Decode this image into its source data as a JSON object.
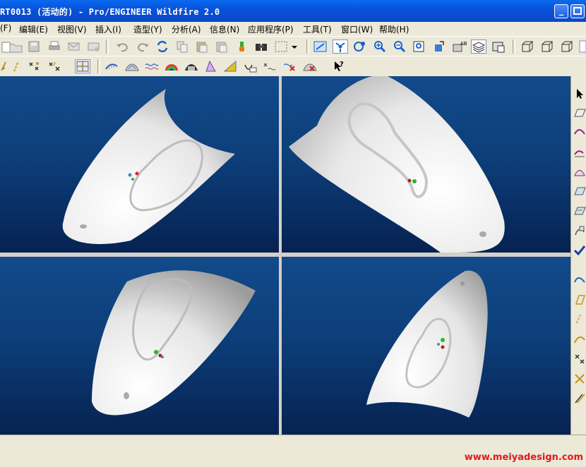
{
  "window": {
    "title": "RT0013 (活动的) - Pro/ENGINEER Wildfire 2.0",
    "minimize_label": "_"
  },
  "menu": [
    {
      "label": "(F)"
    },
    {
      "label": "编辑(E)"
    },
    {
      "label": "视图(V)"
    },
    {
      "label": "插入(I)"
    },
    {
      "label": "造型(Y)"
    },
    {
      "label": "分析(A)"
    },
    {
      "label": "信息(N)"
    },
    {
      "label": "应用程序(P)"
    },
    {
      "label": "工具(T)"
    },
    {
      "label": "窗口(W)"
    },
    {
      "label": "帮助(H)"
    }
  ],
  "toolbar_row1": [
    "new-icon",
    "open-icon",
    "save-icon",
    "print-icon",
    "email-icon",
    "email-link-icon",
    "undo-icon",
    "redo-icon",
    "regenerate-icon",
    "copy-icon",
    "paste-icon",
    "paste-special-icon",
    "model-tree-icon",
    "find-icon",
    "select-box-icon",
    "dropdown-icon",
    "repaint-icon",
    "spin-center-icon",
    "orient-icon",
    "zoom-in-icon",
    "zoom-out-icon",
    "refit-icon",
    "reorient-icon",
    "saved-views-icon",
    "layers-icon",
    "view-manager-icon",
    "wireframe-icon",
    "hidden-line-icon",
    "no-hidden-icon"
  ],
  "toolbar_row2": [
    "datum-plane-toggle-icon",
    "datum-axis-toggle-icon",
    "point-toggle-icon",
    "csys-toggle-icon",
    "four-views-icon",
    "curvature-icon",
    "section-icon",
    "offset-icon",
    "reflection-icon",
    "shade-icon",
    "draft-icon",
    "slope-icon",
    "connection-icon",
    "deviation-icon",
    "delete-analysis-icon",
    "hide-analysis-icon",
    "context-help-icon"
  ],
  "right_toolbar": [
    "select-arrow-icon",
    "plane-icon",
    "curve-icon",
    "curve-on-surface-icon",
    "boundary-surface-icon",
    "surface-icon",
    "surface-edit-icon",
    "trim-icon",
    "checkmark-icon",
    "free-curve-icon",
    "drop-curve-icon",
    "offset-curve-icon",
    "curve-blend-icon",
    "delete-curve-icon",
    "cut-curve-icon",
    "tool-icon"
  ],
  "status": {
    "watermark": "www.meiyadesign.com"
  }
}
